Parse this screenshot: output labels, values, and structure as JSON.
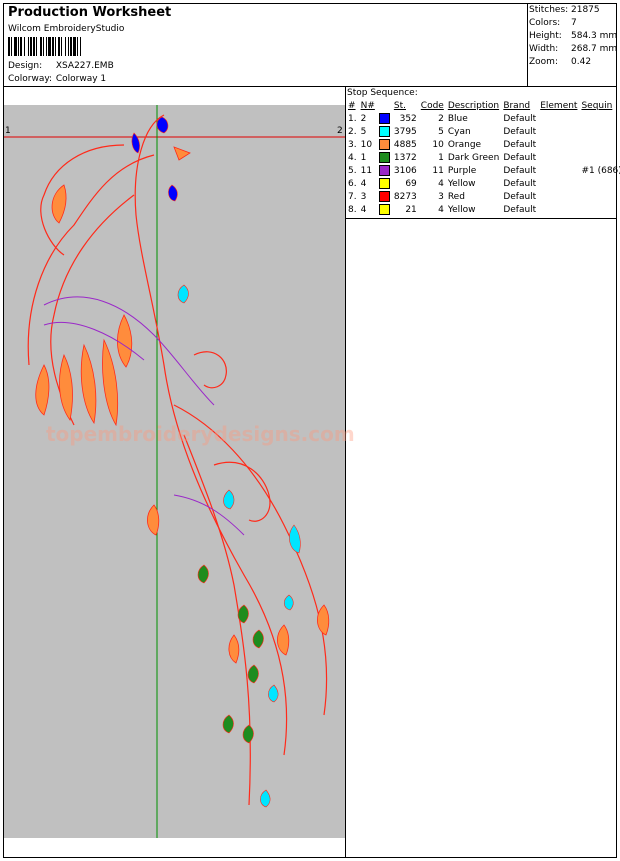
{
  "header": {
    "title": "Production Worksheet",
    "software": "Wilcom EmbroideryStudio",
    "design_label": "Design:",
    "design_value": "XSA227.EMB",
    "colorway_label": "Colorway:",
    "colorway_value": "Colorway 1"
  },
  "stats": [
    {
      "label": "Stitches:",
      "value": "21875"
    },
    {
      "label": "Colors:",
      "value": "7"
    },
    {
      "label": "Height:",
      "value": "584.3 mm"
    },
    {
      "label": "Width:",
      "value": "268.7 mm"
    },
    {
      "label": "Zoom:",
      "value": "0.42"
    }
  ],
  "stop_sequence": {
    "title": "Stop Sequence:",
    "headers": {
      "num": "#",
      "n": "N#",
      "st": "St.",
      "code": "Code",
      "description": "Description",
      "brand": "Brand",
      "element": "Element",
      "sequin": "Sequin"
    },
    "rows": [
      {
        "num": "1.",
        "n": "2",
        "color": "#0000ff",
        "st": "352",
        "code": "2",
        "description": "Blue",
        "brand": "Default",
        "element": "",
        "sequin": ""
      },
      {
        "num": "2.",
        "n": "5",
        "color": "#00ffff",
        "st": "3795",
        "code": "5",
        "description": "Cyan",
        "brand": "Default",
        "element": "",
        "sequin": ""
      },
      {
        "num": "3.",
        "n": "10",
        "color": "#ff8c3c",
        "st": "4885",
        "code": "10",
        "description": "Orange",
        "brand": "Default",
        "element": "",
        "sequin": ""
      },
      {
        "num": "4.",
        "n": "1",
        "color": "#1e8c1e",
        "st": "1372",
        "code": "1",
        "description": "Dark Green",
        "brand": "Default",
        "element": "",
        "sequin": ""
      },
      {
        "num": "5.",
        "n": "11",
        "color": "#9a28c8",
        "st": "3106",
        "code": "11",
        "description": "Purple",
        "brand": "Default",
        "element": "",
        "sequin": "#1 (686)"
      },
      {
        "num": "6.",
        "n": "4",
        "color": "#ffff00",
        "st": "69",
        "code": "4",
        "description": "Yellow",
        "brand": "Default",
        "element": "",
        "sequin": ""
      },
      {
        "num": "7.",
        "n": "3",
        "color": "#ff0000",
        "st": "8273",
        "code": "3",
        "description": "Red",
        "brand": "Default",
        "element": "",
        "sequin": ""
      },
      {
        "num": "8.",
        "n": "4",
        "color": "#ffff00",
        "st": "21",
        "code": "4",
        "description": "Yellow",
        "brand": "Default",
        "element": "",
        "sequin": ""
      }
    ]
  },
  "design_preview": {
    "marker_start": "1",
    "marker_end": "2",
    "watermark": "topembroiderydesigns.com",
    "background_color": "#c0c0c0"
  }
}
